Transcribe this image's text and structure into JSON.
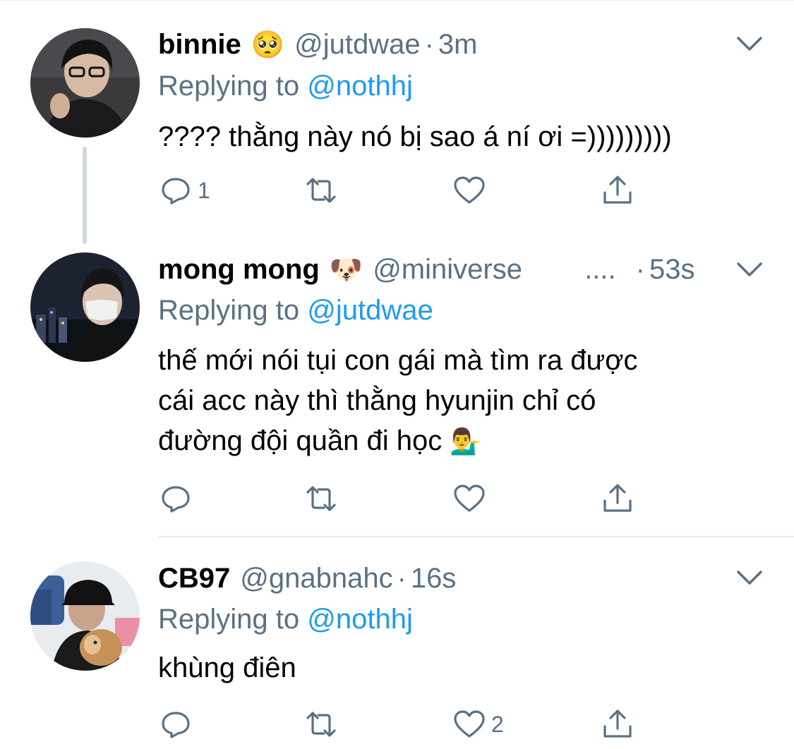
{
  "tweets": [
    {
      "name": "binnie",
      "name_emoji": "🥺",
      "handle": "@jutdwae",
      "handle_ellipsis": "",
      "dot": "·",
      "time": "3m",
      "reply_prefix": "Replying to",
      "reply_to": "@nothhj",
      "text_lines": [
        "???? thằng này nó bị sao á ní ơi =)))))))))"
      ],
      "text_emoji": "",
      "reply_count": "1",
      "like_count": ""
    },
    {
      "name": "mong mong",
      "name_emoji": "🐶",
      "handle": "@miniverse",
      "handle_ellipsis": "....",
      "dot": "·",
      "time": "53s",
      "reply_prefix": "Replying to",
      "reply_to": "@jutdwae",
      "text_lines": [
        "thế mới nói tụi con gái mà tìm ra được",
        "cái acc này thì thằng hyunjin chỉ có",
        "đường đội quần đi học"
      ],
      "text_emoji": "💁‍♂️",
      "reply_count": "",
      "like_count": ""
    },
    {
      "name": "CB97",
      "name_emoji": "",
      "handle": "@gnabnahc",
      "handle_ellipsis": "",
      "dot": "·",
      "time": "16s",
      "reply_prefix": "Replying to",
      "reply_to": "@nothhj",
      "text_lines": [
        "khùng điên"
      ],
      "text_emoji": "",
      "reply_count": "",
      "like_count": "2"
    }
  ],
  "icons": {
    "reply": "reply-icon",
    "retweet": "retweet-icon",
    "like": "heart-icon",
    "share": "share-icon",
    "caret": "chevron-down-icon"
  },
  "colors": {
    "secondary_text": "#5b7083",
    "link": "#1d9bf0",
    "divider": "#e6ecf0",
    "thread_line": "#cfd9de"
  }
}
